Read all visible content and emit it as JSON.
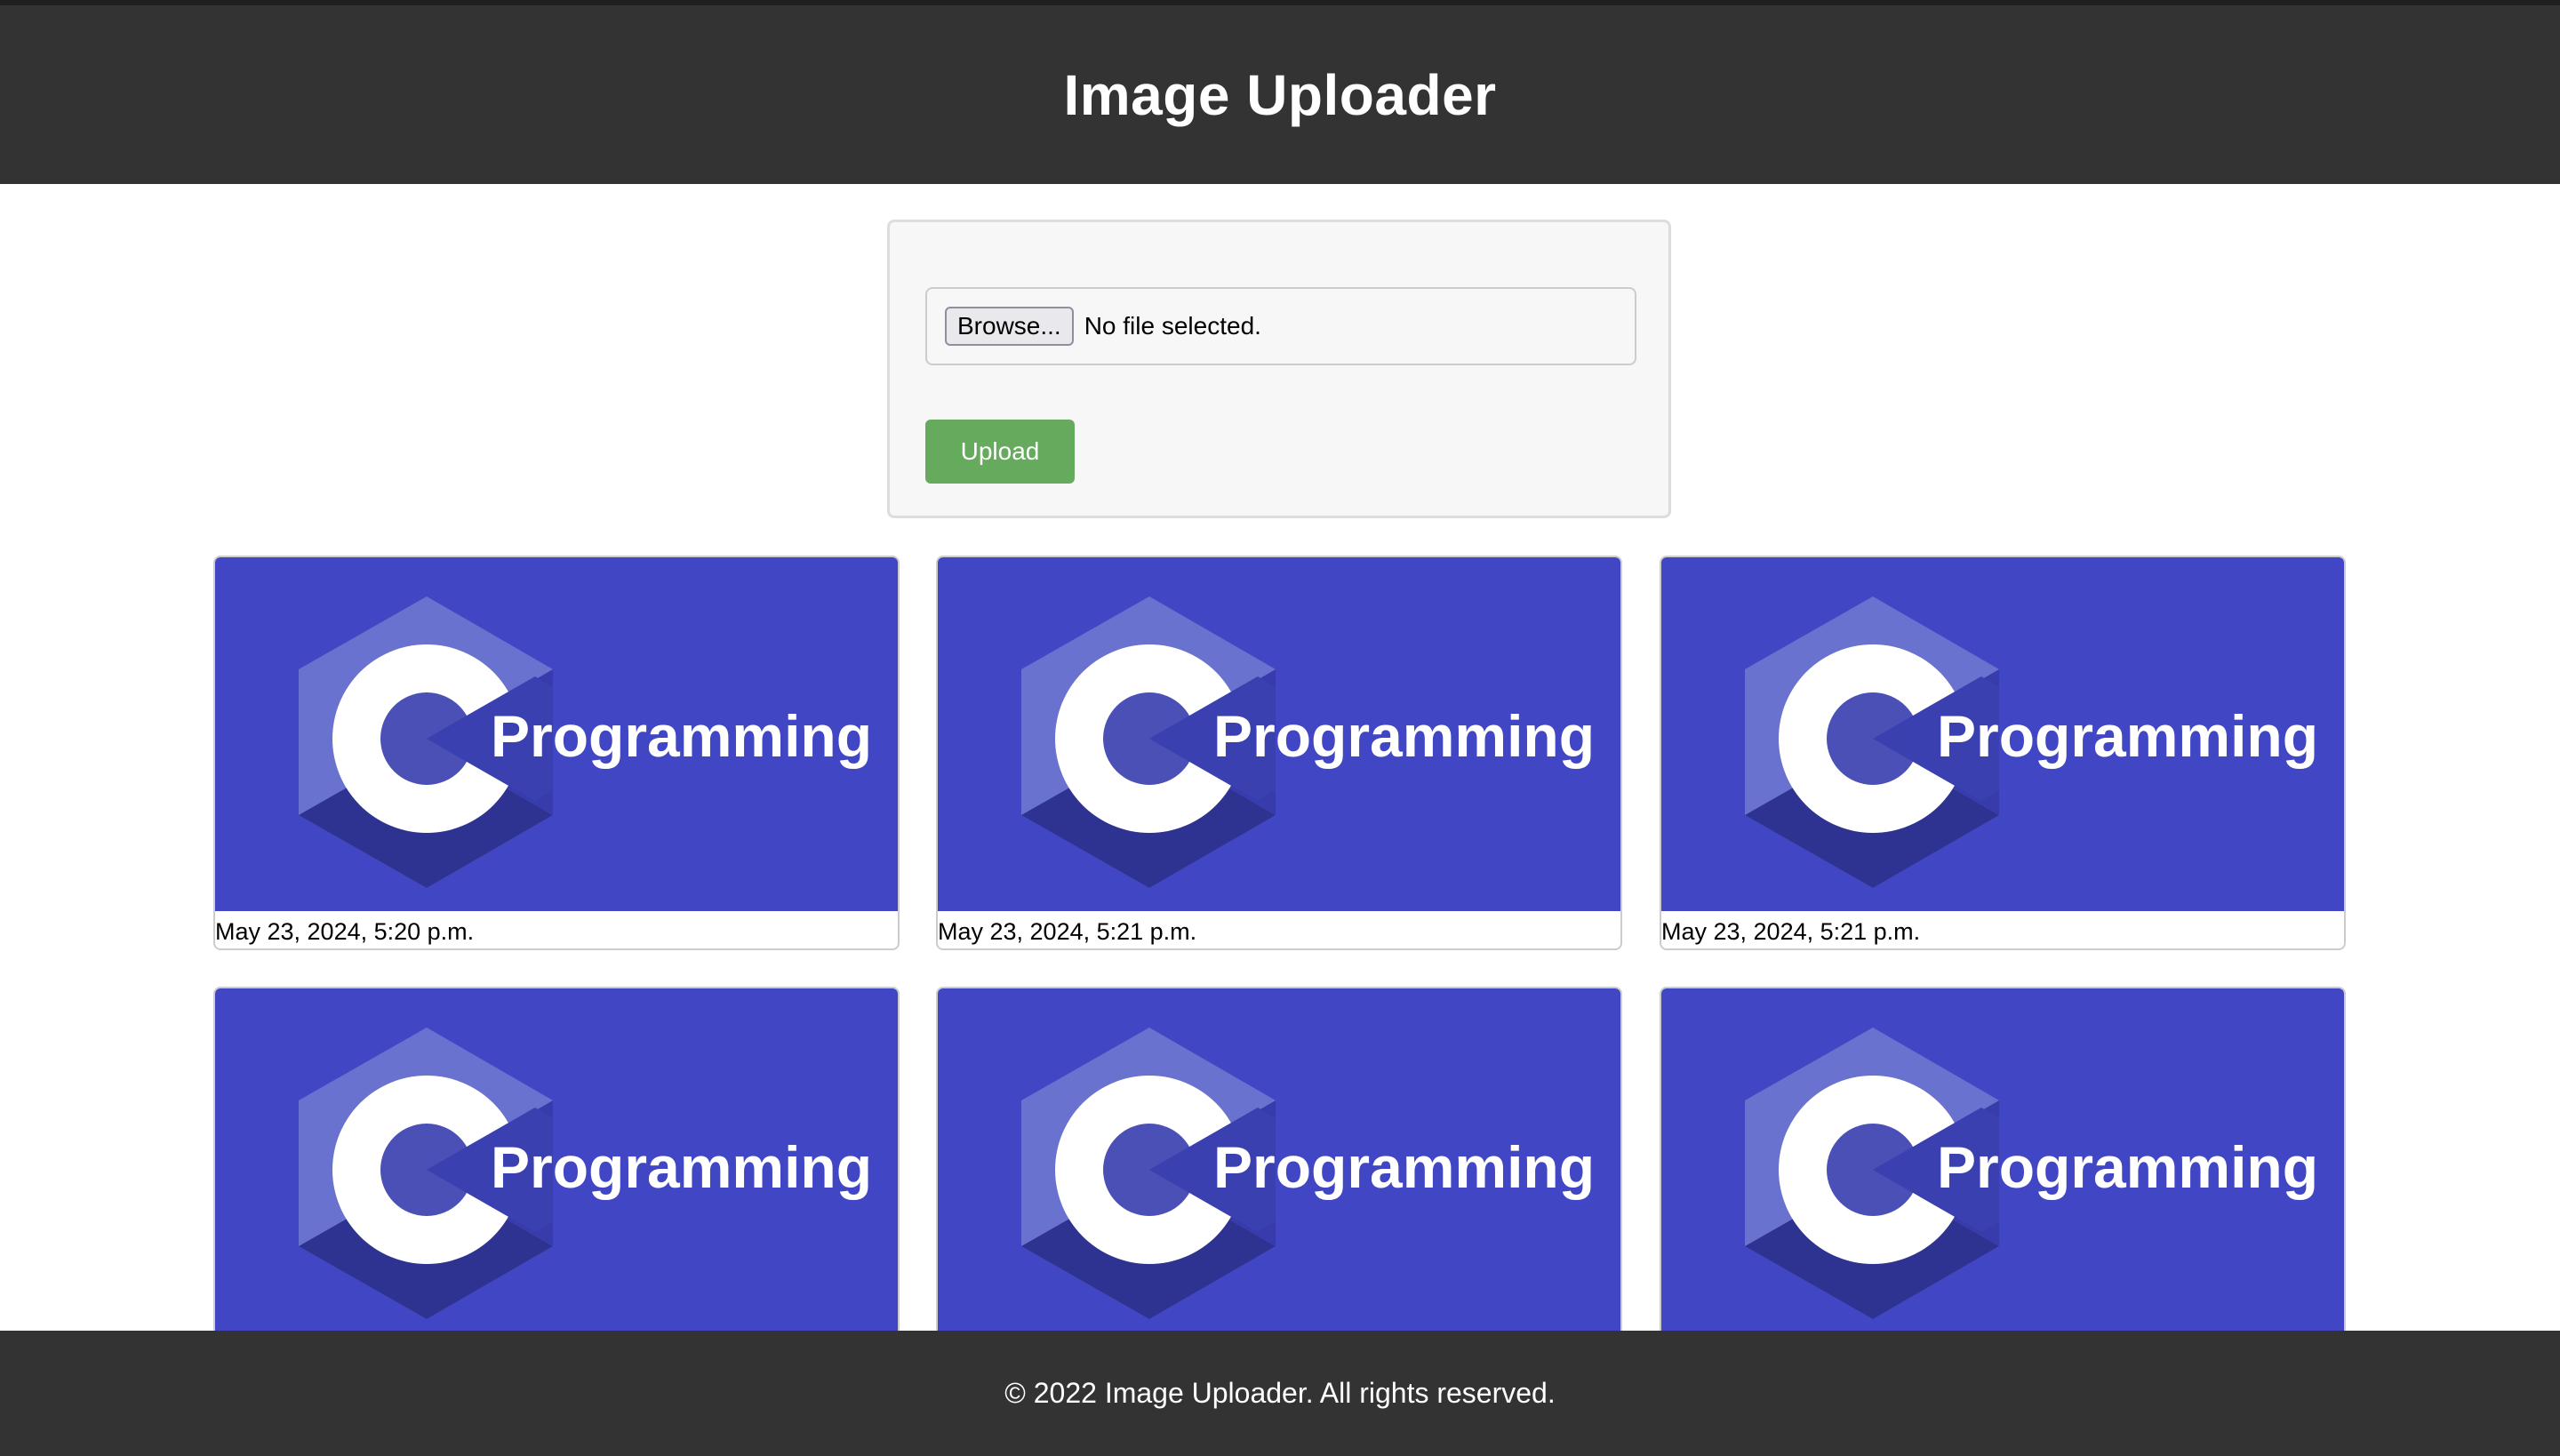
{
  "header": {
    "title": "Image Uploader"
  },
  "upload_form": {
    "browse_label": "Browse...",
    "file_status": "No file selected.",
    "upload_label": "Upload"
  },
  "gallery": {
    "logo_text": "Programming",
    "logo_letter": "C",
    "items": [
      {
        "caption": "May 23, 2024, 5:20 p.m."
      },
      {
        "caption": "May 23, 2024, 5:21 p.m."
      },
      {
        "caption": "May 23, 2024, 5:21 p.m."
      },
      {
        "caption": ""
      },
      {
        "caption": ""
      },
      {
        "caption": ""
      }
    ]
  },
  "footer": {
    "text": "© 2022 Image Uploader. All rights reserved."
  },
  "colors": {
    "header_bg": "#333333",
    "upload_button": "#66aa5e",
    "thumbnail_bg": "#4147c4"
  }
}
